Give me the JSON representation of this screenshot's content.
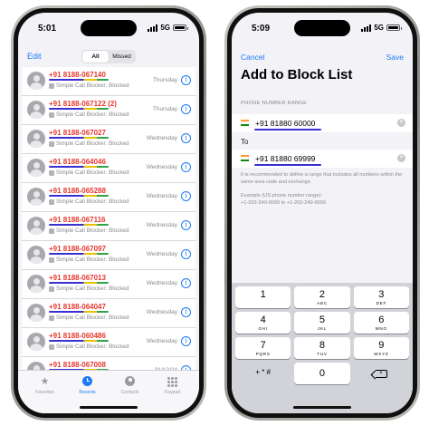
{
  "left_phone": {
    "status": {
      "time": "5:01",
      "network": "5G"
    },
    "nav": {
      "edit": "Edit",
      "segments": [
        "All",
        "Missed"
      ],
      "selected": "All"
    },
    "calls": [
      {
        "number": "+91 8188-067140",
        "count": "",
        "sub": "Simple Call Blocker: Blocked",
        "day": "Thursday"
      },
      {
        "number": "+91 8188-067122",
        "count": "(2)",
        "sub": "Simple Call Blocker: Blocked",
        "day": "Thursday"
      },
      {
        "number": "+91 8188-067027",
        "count": "",
        "sub": "Simple Call Blocker: Blocked",
        "day": "Wednesday"
      },
      {
        "number": "+91 8188-064046",
        "count": "",
        "sub": "Simple Call Blocker: Blocked",
        "day": "Wednesday"
      },
      {
        "number": "+91 8188-065288",
        "count": "",
        "sub": "Simple Call Blocker: Blocked",
        "day": "Wednesday"
      },
      {
        "number": "+91 8188-067116",
        "count": "",
        "sub": "Simple Call Blocker: Blocked",
        "day": "Wednesday"
      },
      {
        "number": "+91 8188-067097",
        "count": "",
        "sub": "Simple Call Blocker: Blocked",
        "day": "Wednesday"
      },
      {
        "number": "+91 8188-067013",
        "count": "",
        "sub": "Simple Call Blocker: Blocked",
        "day": "Wednesday"
      },
      {
        "number": "+91 8188-064047",
        "count": "",
        "sub": "Simple Call Blocker: Blocked",
        "day": "Wednesday"
      },
      {
        "number": "+91 8188-060486",
        "count": "",
        "sub": "Simple Call Blocker: Blocked",
        "day": "Wednesday"
      },
      {
        "number": "+91 8188-067008",
        "count": "",
        "sub": "Simple Call Blocker: Blocked",
        "day": "31/12/24"
      }
    ],
    "tabs": [
      {
        "label": "Favorites",
        "icon": "star-icon"
      },
      {
        "label": "Recents",
        "icon": "clock-icon"
      },
      {
        "label": "Contacts",
        "icon": "contact-icon"
      },
      {
        "label": "Keypad",
        "icon": "keypad-icon"
      }
    ],
    "colors": {
      "accent": "#1e7bf6",
      "blocked_number": "#e6382f"
    }
  },
  "right_phone": {
    "status": {
      "time": "5:09",
      "network": "5G"
    },
    "cancel": "Cancel",
    "save": "Save",
    "title": "Add to Block List",
    "section_header": "PHONE NUMBER RANGE",
    "range_start": "+91 81880 60000",
    "to_label": "To",
    "range_end": "+91 81880 69999",
    "hint": "It is recommended to define a range that includes all numbers within the same area code and exchange.",
    "example": "Example (US phone number range):\n+1-202-240-0000 to +1-202-240-9999",
    "keypad": {
      "keys": [
        {
          "n": "1",
          "l": ""
        },
        {
          "n": "2",
          "l": "ABC"
        },
        {
          "n": "3",
          "l": "DEF"
        },
        {
          "n": "4",
          "l": "GHI"
        },
        {
          "n": "5",
          "l": "JKL"
        },
        {
          "n": "6",
          "l": "MNO"
        },
        {
          "n": "7",
          "l": "PQRS"
        },
        {
          "n": "8",
          "l": "TUV"
        },
        {
          "n": "9",
          "l": "WXYZ"
        }
      ],
      "symbols": "+ * #",
      "zero": "0"
    }
  }
}
